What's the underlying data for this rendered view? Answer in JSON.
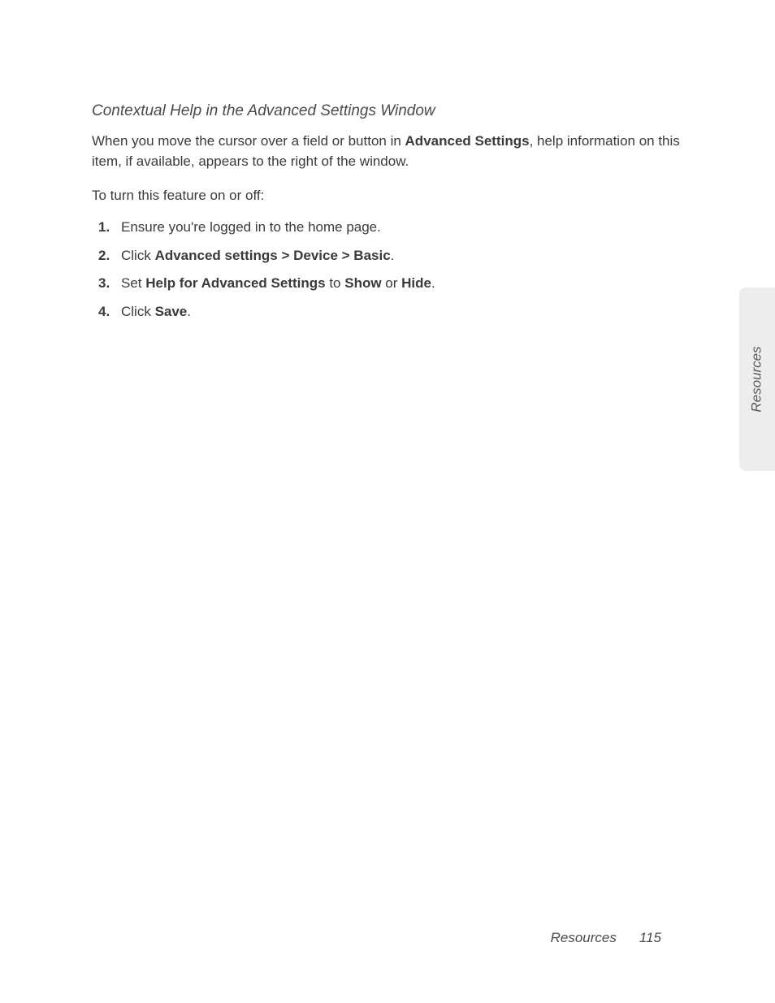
{
  "heading": "Contextual Help in the Advanced Settings Window",
  "intro": {
    "prefix": "When you move the cursor over a field or button in ",
    "bold1": "Advanced Settings",
    "suffix": ", help information on this item, if available, appears to the right of the window."
  },
  "toggleText": "To turn this feature on or off:",
  "steps": {
    "s1": "Ensure you're logged in to the home page.",
    "s2": {
      "p1": "Click ",
      "b1": "Advanced settings",
      "gt1": " > ",
      "b2": "Device",
      "gt2": " > ",
      "b3": "Basic",
      "p2": "."
    },
    "s3": {
      "p1": "Set ",
      "b1": "Help for Advanced Settings",
      "p2": " to ",
      "b2": "Show",
      "p3": " or ",
      "b3": "Hide",
      "p4": "."
    },
    "s4": {
      "p1": "Click ",
      "b1": "Save",
      "p2": "."
    }
  },
  "sideTab": "Resources",
  "footer": {
    "section": "Resources",
    "page": "115"
  }
}
